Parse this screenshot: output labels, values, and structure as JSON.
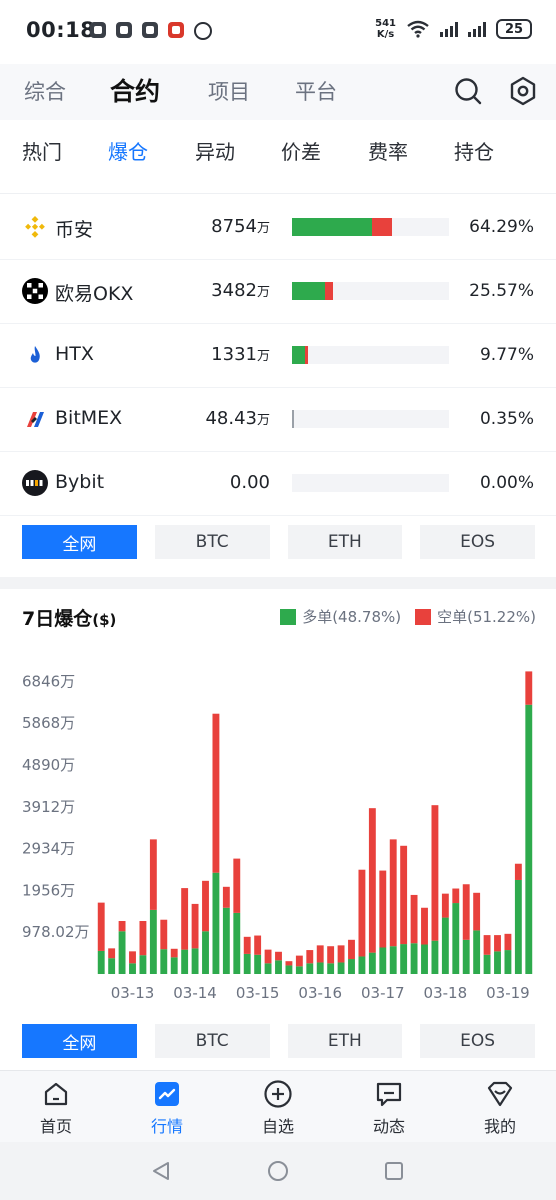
{
  "status_bar": {
    "time": "00:18",
    "net_speed_value": "541",
    "net_speed_unit": "K/s",
    "battery": "25"
  },
  "top_nav": {
    "tabs": [
      "综合",
      "合约",
      "项目",
      "平台"
    ],
    "active": "合约"
  },
  "sub_nav": {
    "tabs": [
      "热门",
      "爆仓",
      "异动",
      "价差",
      "费率",
      "持仓"
    ],
    "active": "爆仓"
  },
  "exchanges": [
    {
      "name": "币安",
      "amount": "8754",
      "unit": "万",
      "long_fraction": 0.51,
      "short_fraction": 0.13,
      "percent": "64.29%"
    },
    {
      "name": "欧易OKX",
      "amount": "3482",
      "unit": "万",
      "long_fraction": 0.21,
      "short_fraction": 0.05,
      "percent": "25.57%"
    },
    {
      "name": "HTX",
      "amount": "1331",
      "unit": "万",
      "long_fraction": 0.08,
      "short_fraction": 0.02,
      "percent": "9.77%"
    },
    {
      "name": "BitMEX",
      "amount": "48.43",
      "unit": "万",
      "long_fraction": 0.004,
      "short_fraction": 0.0,
      "percent": "0.35%"
    },
    {
      "name": "Bybit",
      "amount": "0.00",
      "unit": "",
      "long_fraction": 0.0,
      "short_fraction": 0.0,
      "percent": "0.00%"
    }
  ],
  "coin_filter": {
    "options": [
      "全网",
      "BTC",
      "ETH",
      "EOS"
    ],
    "active": "全网"
  },
  "chart_section": {
    "title": "7日爆仓",
    "title_unit": "($)",
    "legend_long": "多单(48.78%)",
    "legend_short": "空单(51.22%)"
  },
  "chart_data": {
    "type": "bar",
    "stacked": true,
    "y_tick_labels": [
      "978.02万",
      "1956万",
      "2934万",
      "3912万",
      "4890万",
      "5868万",
      "6846万"
    ],
    "y_ticks": [
      978.02,
      1956,
      2934,
      3912,
      4890,
      5868,
      6846
    ],
    "ylim": [
      0,
      7300
    ],
    "x_tick_labels": [
      "03-13",
      "03-14",
      "03-15",
      "03-16",
      "03-17",
      "03-18",
      "03-19"
    ],
    "x_tick_positions": [
      3.5,
      9.5,
      15.5,
      21.5,
      27.5,
      33.5,
      39.5
    ],
    "bar_count": 42,
    "series": [
      {
        "name": "多单",
        "color": "#2eaa4d",
        "values": [
          540,
          370,
          1000,
          250,
          440,
          1500,
          580,
          390,
          570,
          600,
          1000,
          2370,
          1550,
          1430,
          470,
          450,
          250,
          320,
          200,
          180,
          250,
          270,
          250,
          270,
          350,
          410,
          500,
          620,
          650,
          700,
          720,
          690,
          780,
          1320,
          1660,
          800,
          1020,
          450,
          530,
          560,
          2200,
          6300
        ]
      },
      {
        "name": "空单",
        "color": "#e8413c",
        "values": [
          1130,
          230,
          240,
          280,
          800,
          1650,
          690,
          200,
          1440,
          1040,
          1180,
          3720,
          490,
          1270,
          400,
          450,
          320,
          200,
          100,
          250,
          310,
          400,
          400,
          400,
          450,
          2030,
          3380,
          1800,
          2500,
          2300,
          1130,
          860,
          3170,
          560,
          340,
          1300,
          880,
          460,
          380,
          380,
          380,
          780
        ]
      }
    ],
    "grid": false
  },
  "bottom_nav": {
    "items": [
      "首页",
      "行情",
      "自选",
      "动态",
      "我的"
    ],
    "active": "行情"
  }
}
